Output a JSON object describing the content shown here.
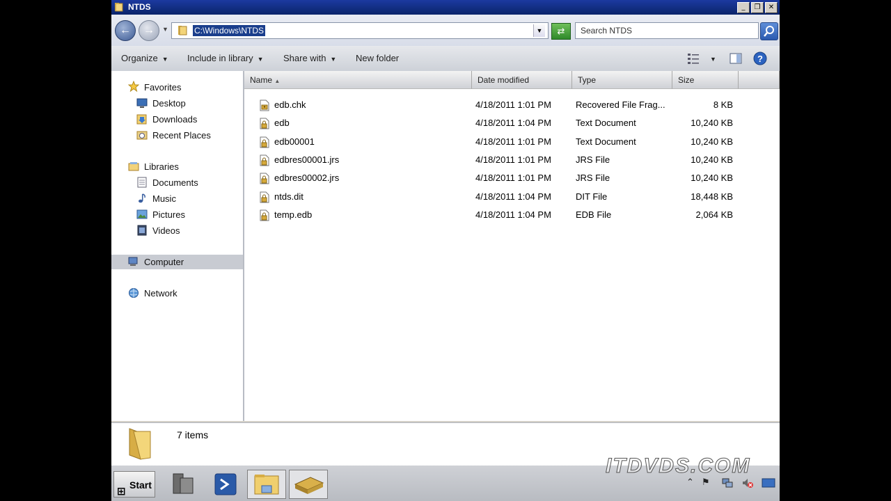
{
  "window": {
    "title": "NTDS",
    "minimize": "_",
    "restore": "❐",
    "close": "✕"
  },
  "address": {
    "path": "C:\\Windows\\NTDS",
    "back": "←",
    "forward": "→",
    "refresh": "⇄"
  },
  "search": {
    "placeholder": "Search NTDS"
  },
  "toolbar": {
    "organize": "Organize",
    "include": "Include in library",
    "share": "Share with",
    "new_folder": "New folder",
    "dropdown": "▼"
  },
  "nav": {
    "favorites": "Favorites",
    "desktop": "Desktop",
    "downloads": "Downloads",
    "recent": "Recent Places",
    "libraries": "Libraries",
    "documents": "Documents",
    "music": "Music",
    "pictures": "Pictures",
    "videos": "Videos",
    "computer": "Computer",
    "network": "Network"
  },
  "columns": {
    "name": "Name",
    "date": "Date modified",
    "type": "Type",
    "size": "Size"
  },
  "files": [
    {
      "name": "edb.chk",
      "date": "4/18/2011 1:01 PM",
      "type": "Recovered File Frag...",
      "size": "8 KB"
    },
    {
      "name": "edb",
      "date": "4/18/2011 1:04 PM",
      "type": "Text Document",
      "size": "10,240 KB"
    },
    {
      "name": "edb00001",
      "date": "4/18/2011 1:01 PM",
      "type": "Text Document",
      "size": "10,240 KB"
    },
    {
      "name": "edbres00001.jrs",
      "date": "4/18/2011 1:01 PM",
      "type": "JRS File",
      "size": "10,240 KB"
    },
    {
      "name": "edbres00002.jrs",
      "date": "4/18/2011 1:01 PM",
      "type": "JRS File",
      "size": "10,240 KB"
    },
    {
      "name": "ntds.dit",
      "date": "4/18/2011 1:04 PM",
      "type": "DIT File",
      "size": "18,448 KB"
    },
    {
      "name": "temp.edb",
      "date": "4/18/2011 1:04 PM",
      "type": "EDB File",
      "size": "2,064 KB"
    }
  ],
  "details": {
    "count": "7 items"
  },
  "taskbar": {
    "start": "Start",
    "watermark": "ITDVDS.COM"
  }
}
